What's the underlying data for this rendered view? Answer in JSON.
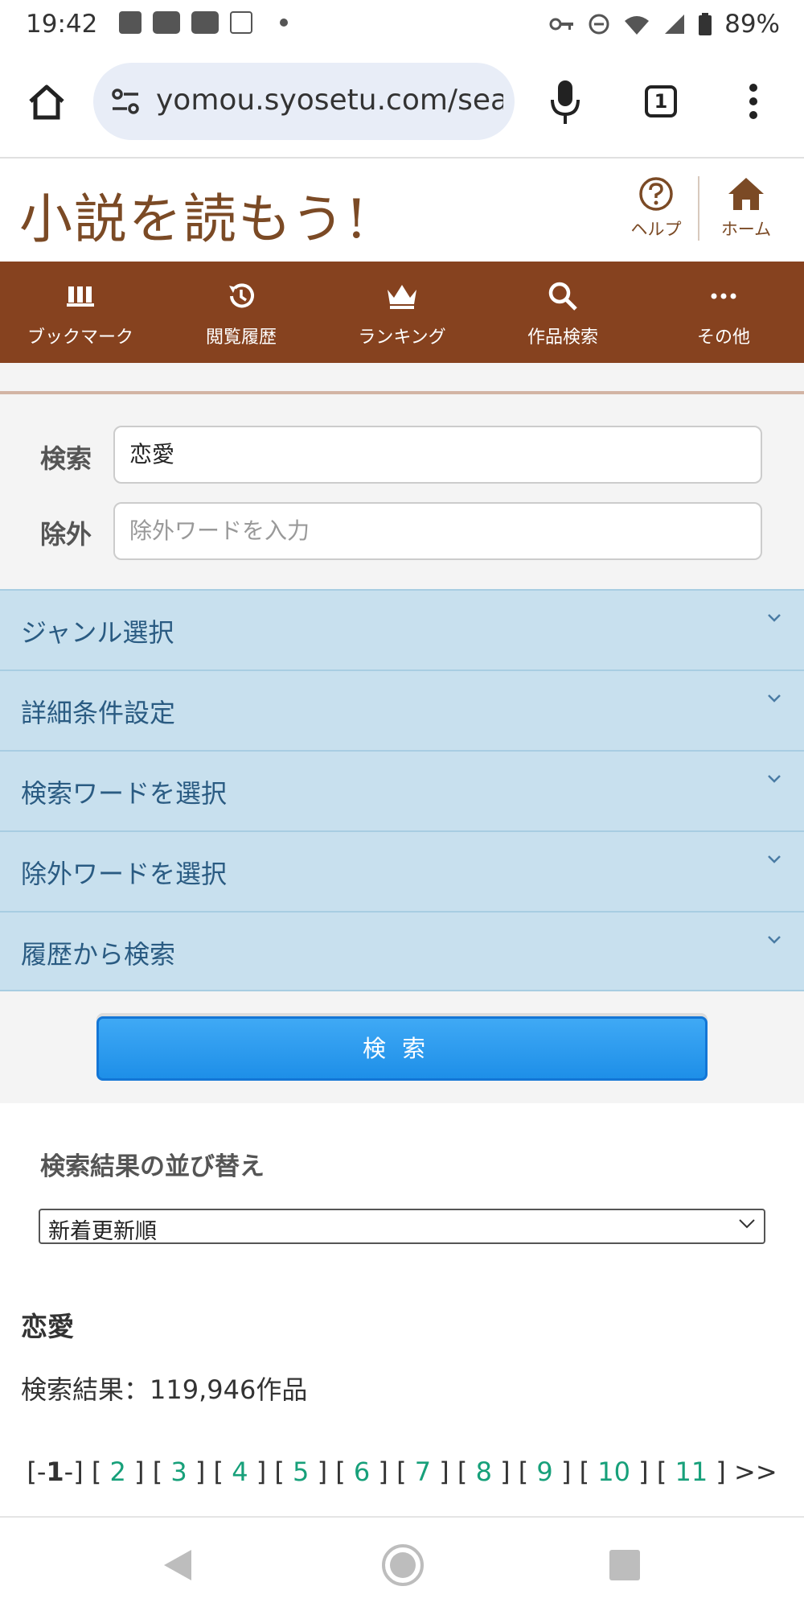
{
  "status_bar": {
    "time": "19:42",
    "battery": "89%"
  },
  "browser": {
    "url": "yomou.syosetu.com/sea",
    "tab_count": "1"
  },
  "site": {
    "logo": "小説を読もう!",
    "help_label": "ヘルプ",
    "home_label": "ホーム"
  },
  "nav": {
    "items": [
      {
        "label": "ブックマーク",
        "icon": "bookmark-icon"
      },
      {
        "label": "閲覧履歴",
        "icon": "history-icon"
      },
      {
        "label": "ランキング",
        "icon": "crown-icon"
      },
      {
        "label": "作品検索",
        "icon": "search-icon"
      },
      {
        "label": "その他",
        "icon": "more-icon"
      }
    ]
  },
  "search": {
    "search_label": "検索",
    "search_value": "恋愛",
    "exclude_label": "除外",
    "exclude_placeholder": "除外ワードを入力",
    "accordion": [
      "ジャンル選択",
      "詳細条件設定",
      "検索ワードを選択",
      "除外ワードを選択",
      "履歴から検索"
    ],
    "submit_label": "検索"
  },
  "results": {
    "sort_title": "検索結果の並び替え",
    "sort_value": "新着更新順",
    "query_title": "恋愛",
    "count_text": "検索結果：119,946作品",
    "pager": {
      "current": "1",
      "pages": [
        "2",
        "3",
        "4",
        "5",
        "6",
        "7",
        "8",
        "9",
        "10",
        "11"
      ],
      "next": ">>"
    }
  },
  "colors": {
    "brand_brown": "#86421f",
    "logo_brown": "#7b4a25",
    "accordion_bg": "#c8e0ee",
    "accordion_text": "#2a5b82",
    "button_blue": "#1e8fe8",
    "link_green": "#17a07a"
  }
}
